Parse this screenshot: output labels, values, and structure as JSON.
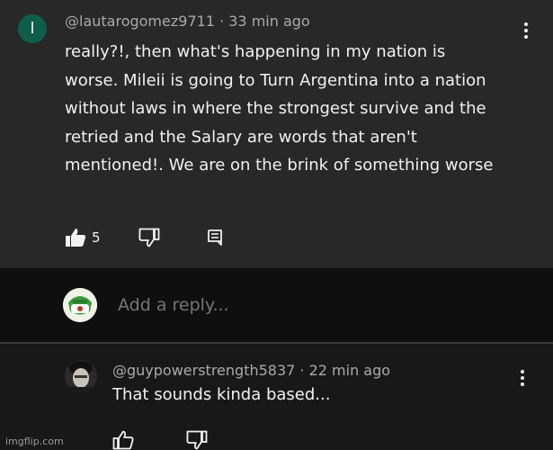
{
  "comment": {
    "username": "@lautarogomez9711",
    "time": "33 min ago",
    "avatar_letter": "l",
    "text": "really?!, then what's happening in my nation is worse. Mileii is going to Turn Argentina into a nation without laws in where the strongest survive and the retried and the Salary are words that aren't mentioned!. We are on the brink of something worse",
    "like_count": "5",
    "icons": {
      "like": "thumbs-up-icon",
      "dislike": "thumbs-down-icon",
      "reply": "comment-icon",
      "more": "more-vertical-icon"
    }
  },
  "reply_input": {
    "placeholder": "Add a reply..."
  },
  "reply": {
    "username": "@guypowerstrength5837",
    "time": "22 min ago",
    "text": "That sounds kinda based..."
  },
  "watermark": "imgflip.com",
  "colors": {
    "background": "#0f0f0f",
    "comment_bg": "#282828",
    "reply_bg": "#181818",
    "avatar": "#0f5d4b",
    "text": "#f1f1f1",
    "meta": "#aaaaaa"
  }
}
